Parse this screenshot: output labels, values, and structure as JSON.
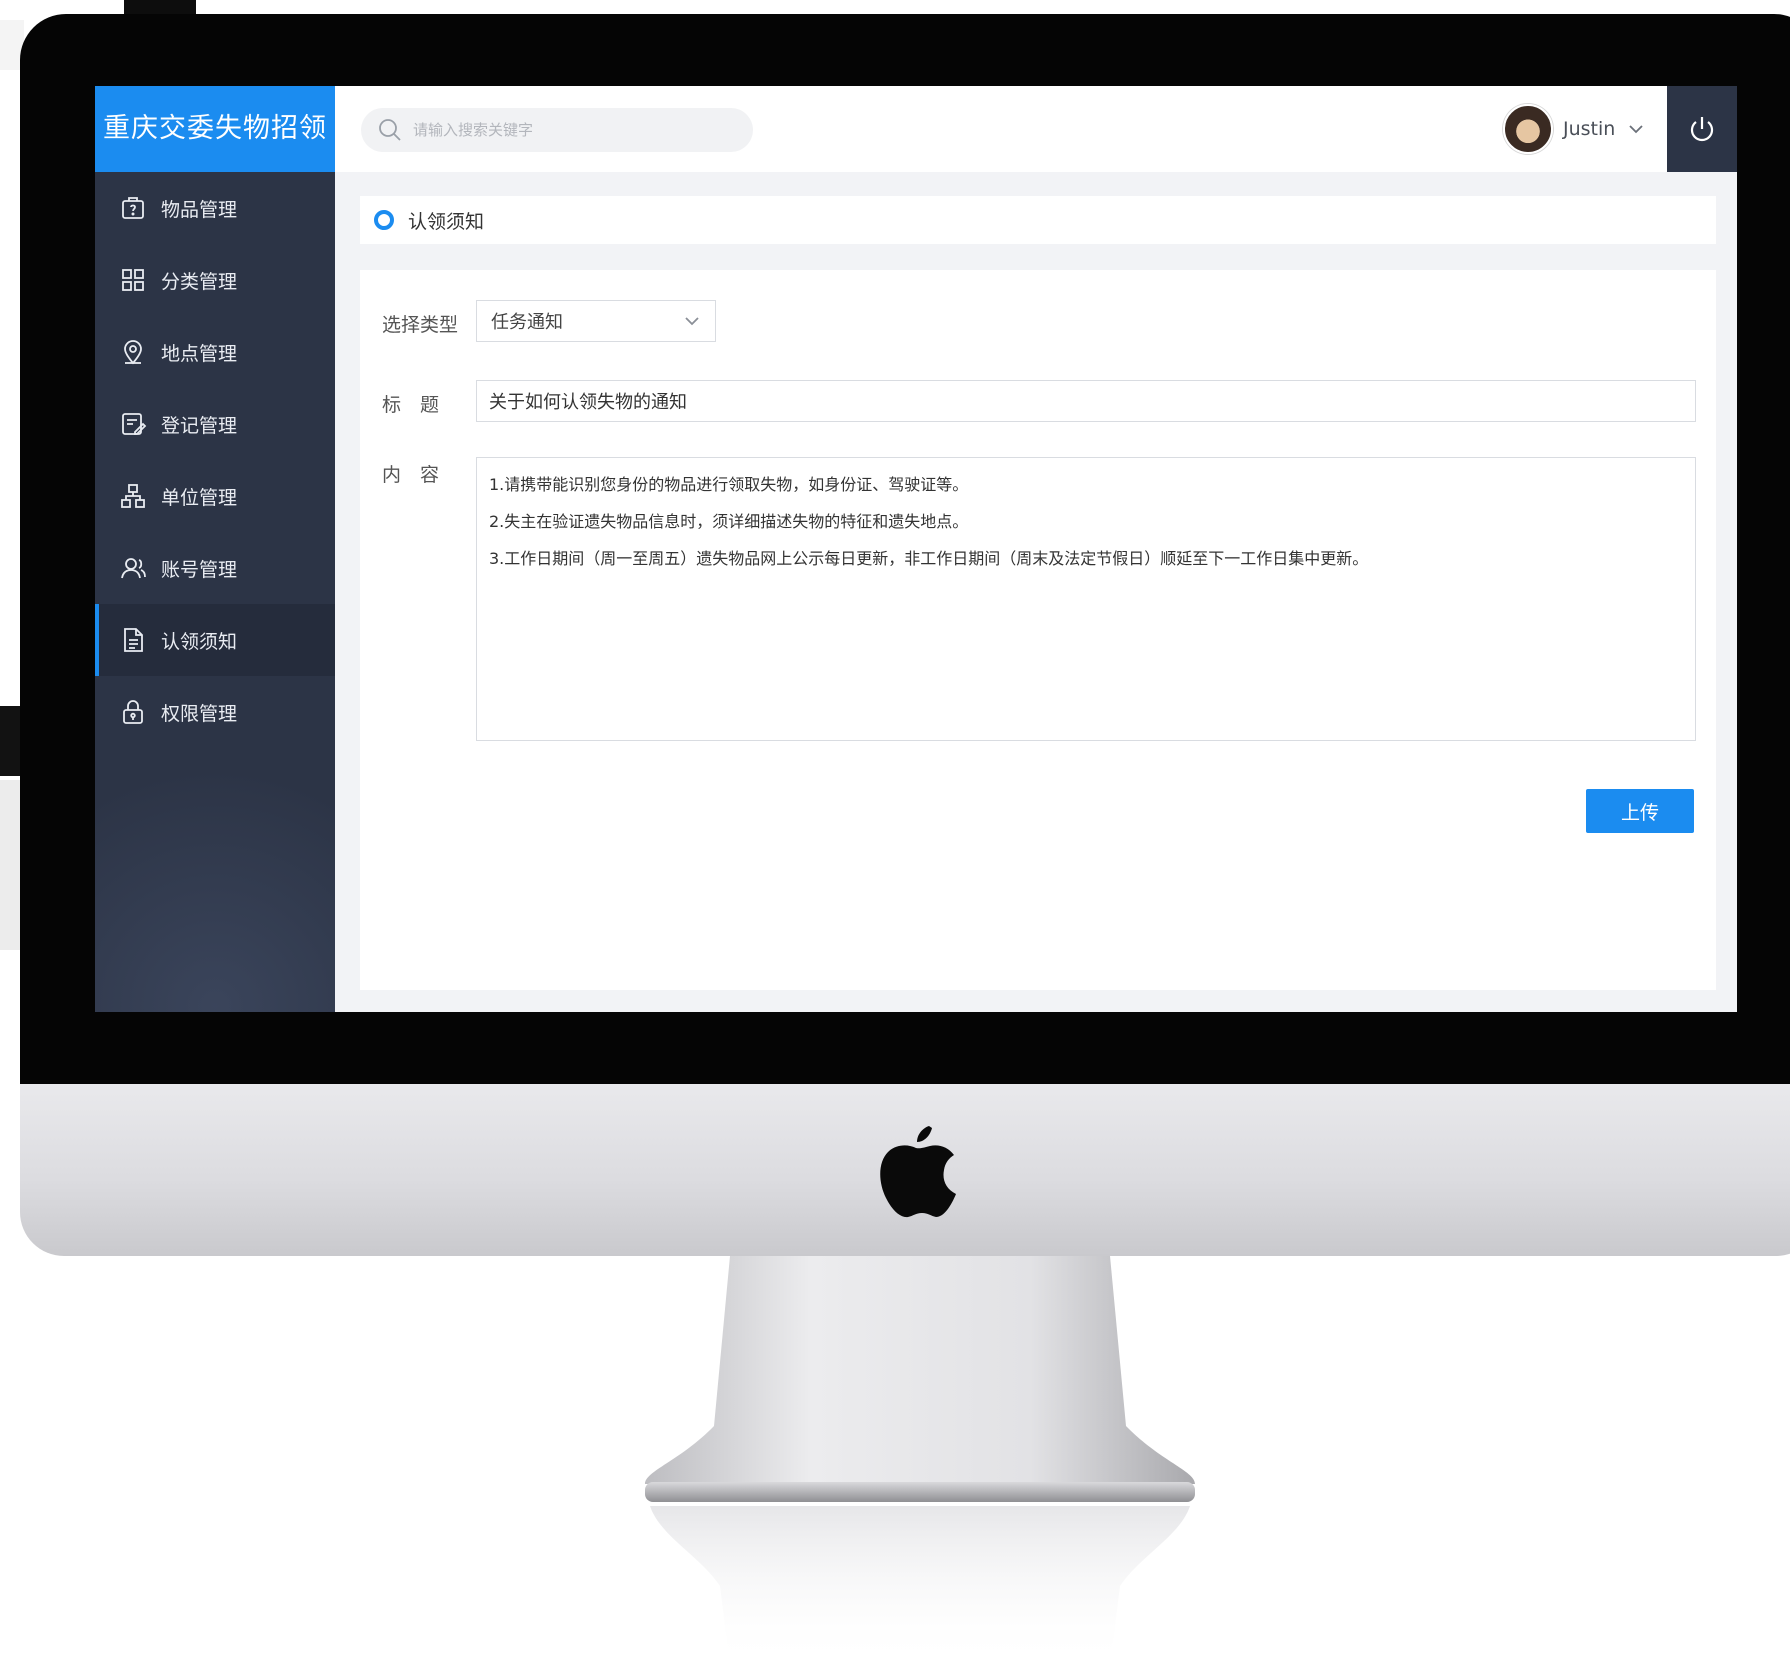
{
  "app": {
    "brand_title": "重庆交委失物招领"
  },
  "search": {
    "placeholder": "请输入搜索关键字"
  },
  "user": {
    "name": "Justin"
  },
  "sidebar": {
    "items": [
      {
        "label": "物品管理",
        "icon": "item-box-icon"
      },
      {
        "label": "分类管理",
        "icon": "category-grid-icon"
      },
      {
        "label": "地点管理",
        "icon": "location-pin-icon"
      },
      {
        "label": "登记管理",
        "icon": "register-edit-icon"
      },
      {
        "label": "单位管理",
        "icon": "org-tree-icon"
      },
      {
        "label": "账号管理",
        "icon": "account-user-icon"
      },
      {
        "label": "认领须知",
        "icon": "notice-document-icon",
        "active": true
      },
      {
        "label": "权限管理",
        "icon": "permission-lock-icon"
      }
    ]
  },
  "page": {
    "title": "认领须知"
  },
  "form": {
    "type_label": "选择类型",
    "type_value": "任务通知",
    "title_label": "标　题",
    "title_value": "关于如何认领失物的通知",
    "content_label": "内　容",
    "content_lines": [
      "1.请携带能识别您身份的物品进行领取失物，如身份证、驾驶证等。",
      "2.失主在验证遗失物品信息时，须详细描述失物的特征和遗失地点。",
      "3.工作日期间（周一至周五）遗失物品网上公示每日更新，非工作日期间（周末及法定节假日）顺延至下一工作日集中更新。"
    ],
    "upload_label": "上传"
  },
  "colors": {
    "accent": "#1b8cf0",
    "sidebar_bg": "#2c3446",
    "content_bg": "#f2f3f6"
  }
}
